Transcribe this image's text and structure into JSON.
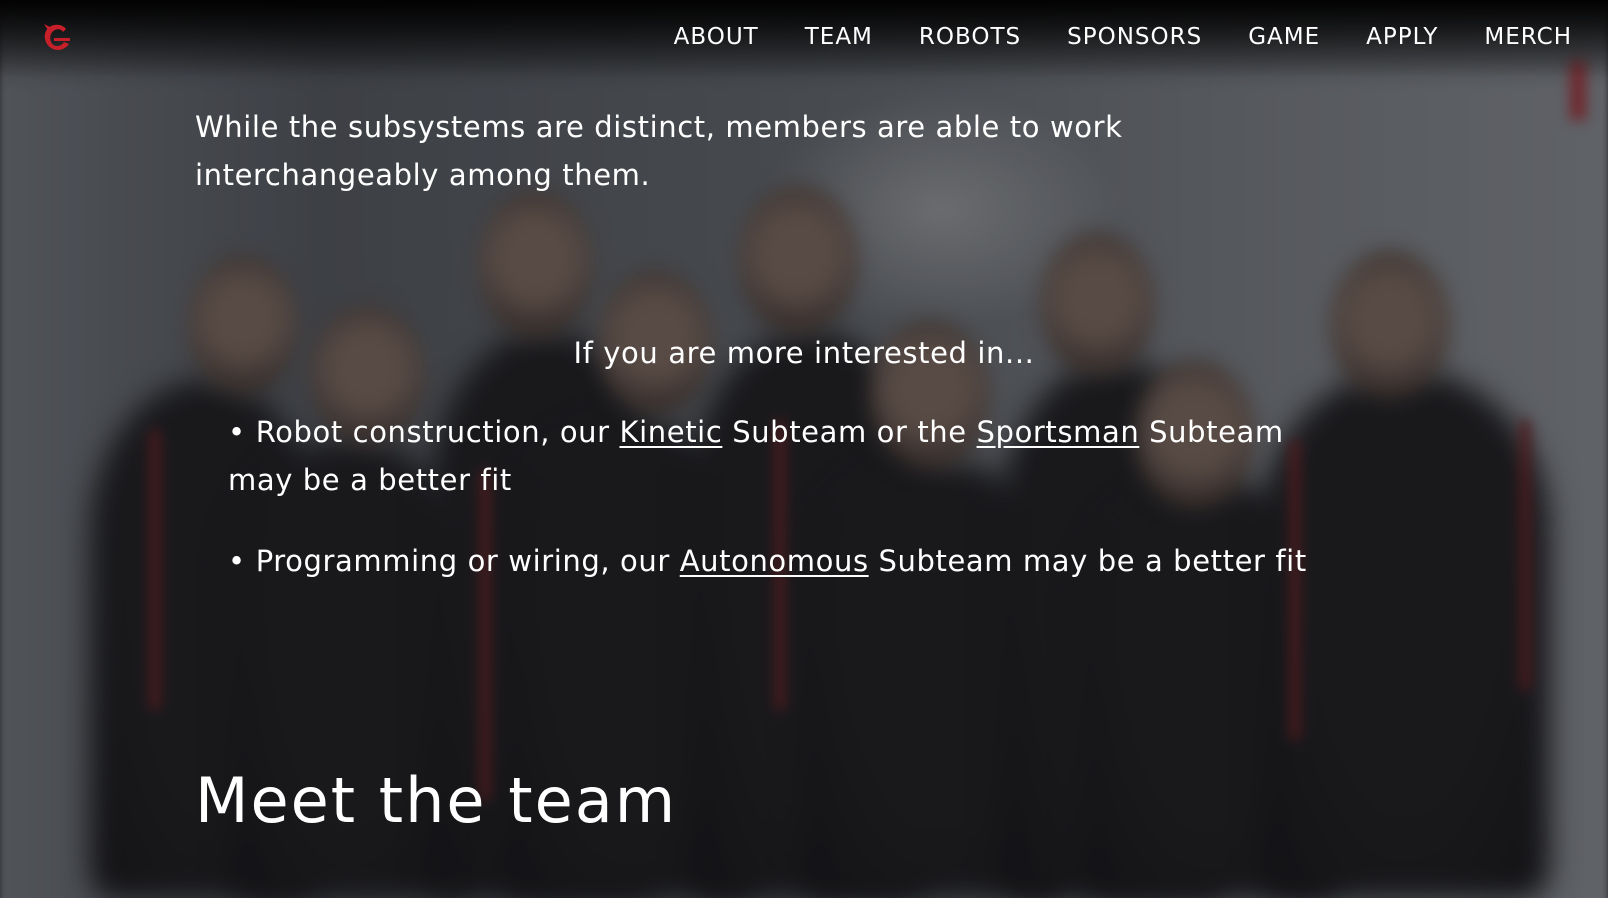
{
  "nav": {
    "items": [
      "ABOUT",
      "TEAM",
      "ROBOTS",
      "SPONSORS",
      "GAME",
      "APPLY",
      "MERCH"
    ]
  },
  "intro": {
    "text": "While the subsystems are distinct, members are able to work interchangeably among them."
  },
  "interest": {
    "heading": "If you are more interested in..."
  },
  "fits": [
    {
      "lead": "Robot construction, our ",
      "link1": "Kinetic",
      "mid": " Subteam or the ",
      "link2": "Sportsman",
      "tail": " Subteam may be a better fit"
    },
    {
      "lead": "Programming or wiring, our ",
      "link1": "Autonomous",
      "tail": " Subteam may be a better fit"
    }
  ],
  "section": {
    "title": "Meet the team"
  },
  "colors": {
    "accent": "#c8202a",
    "text": "#ffffff"
  },
  "icons": {
    "logo": "team-logo-icon",
    "bullet": "bullet-glyph"
  }
}
